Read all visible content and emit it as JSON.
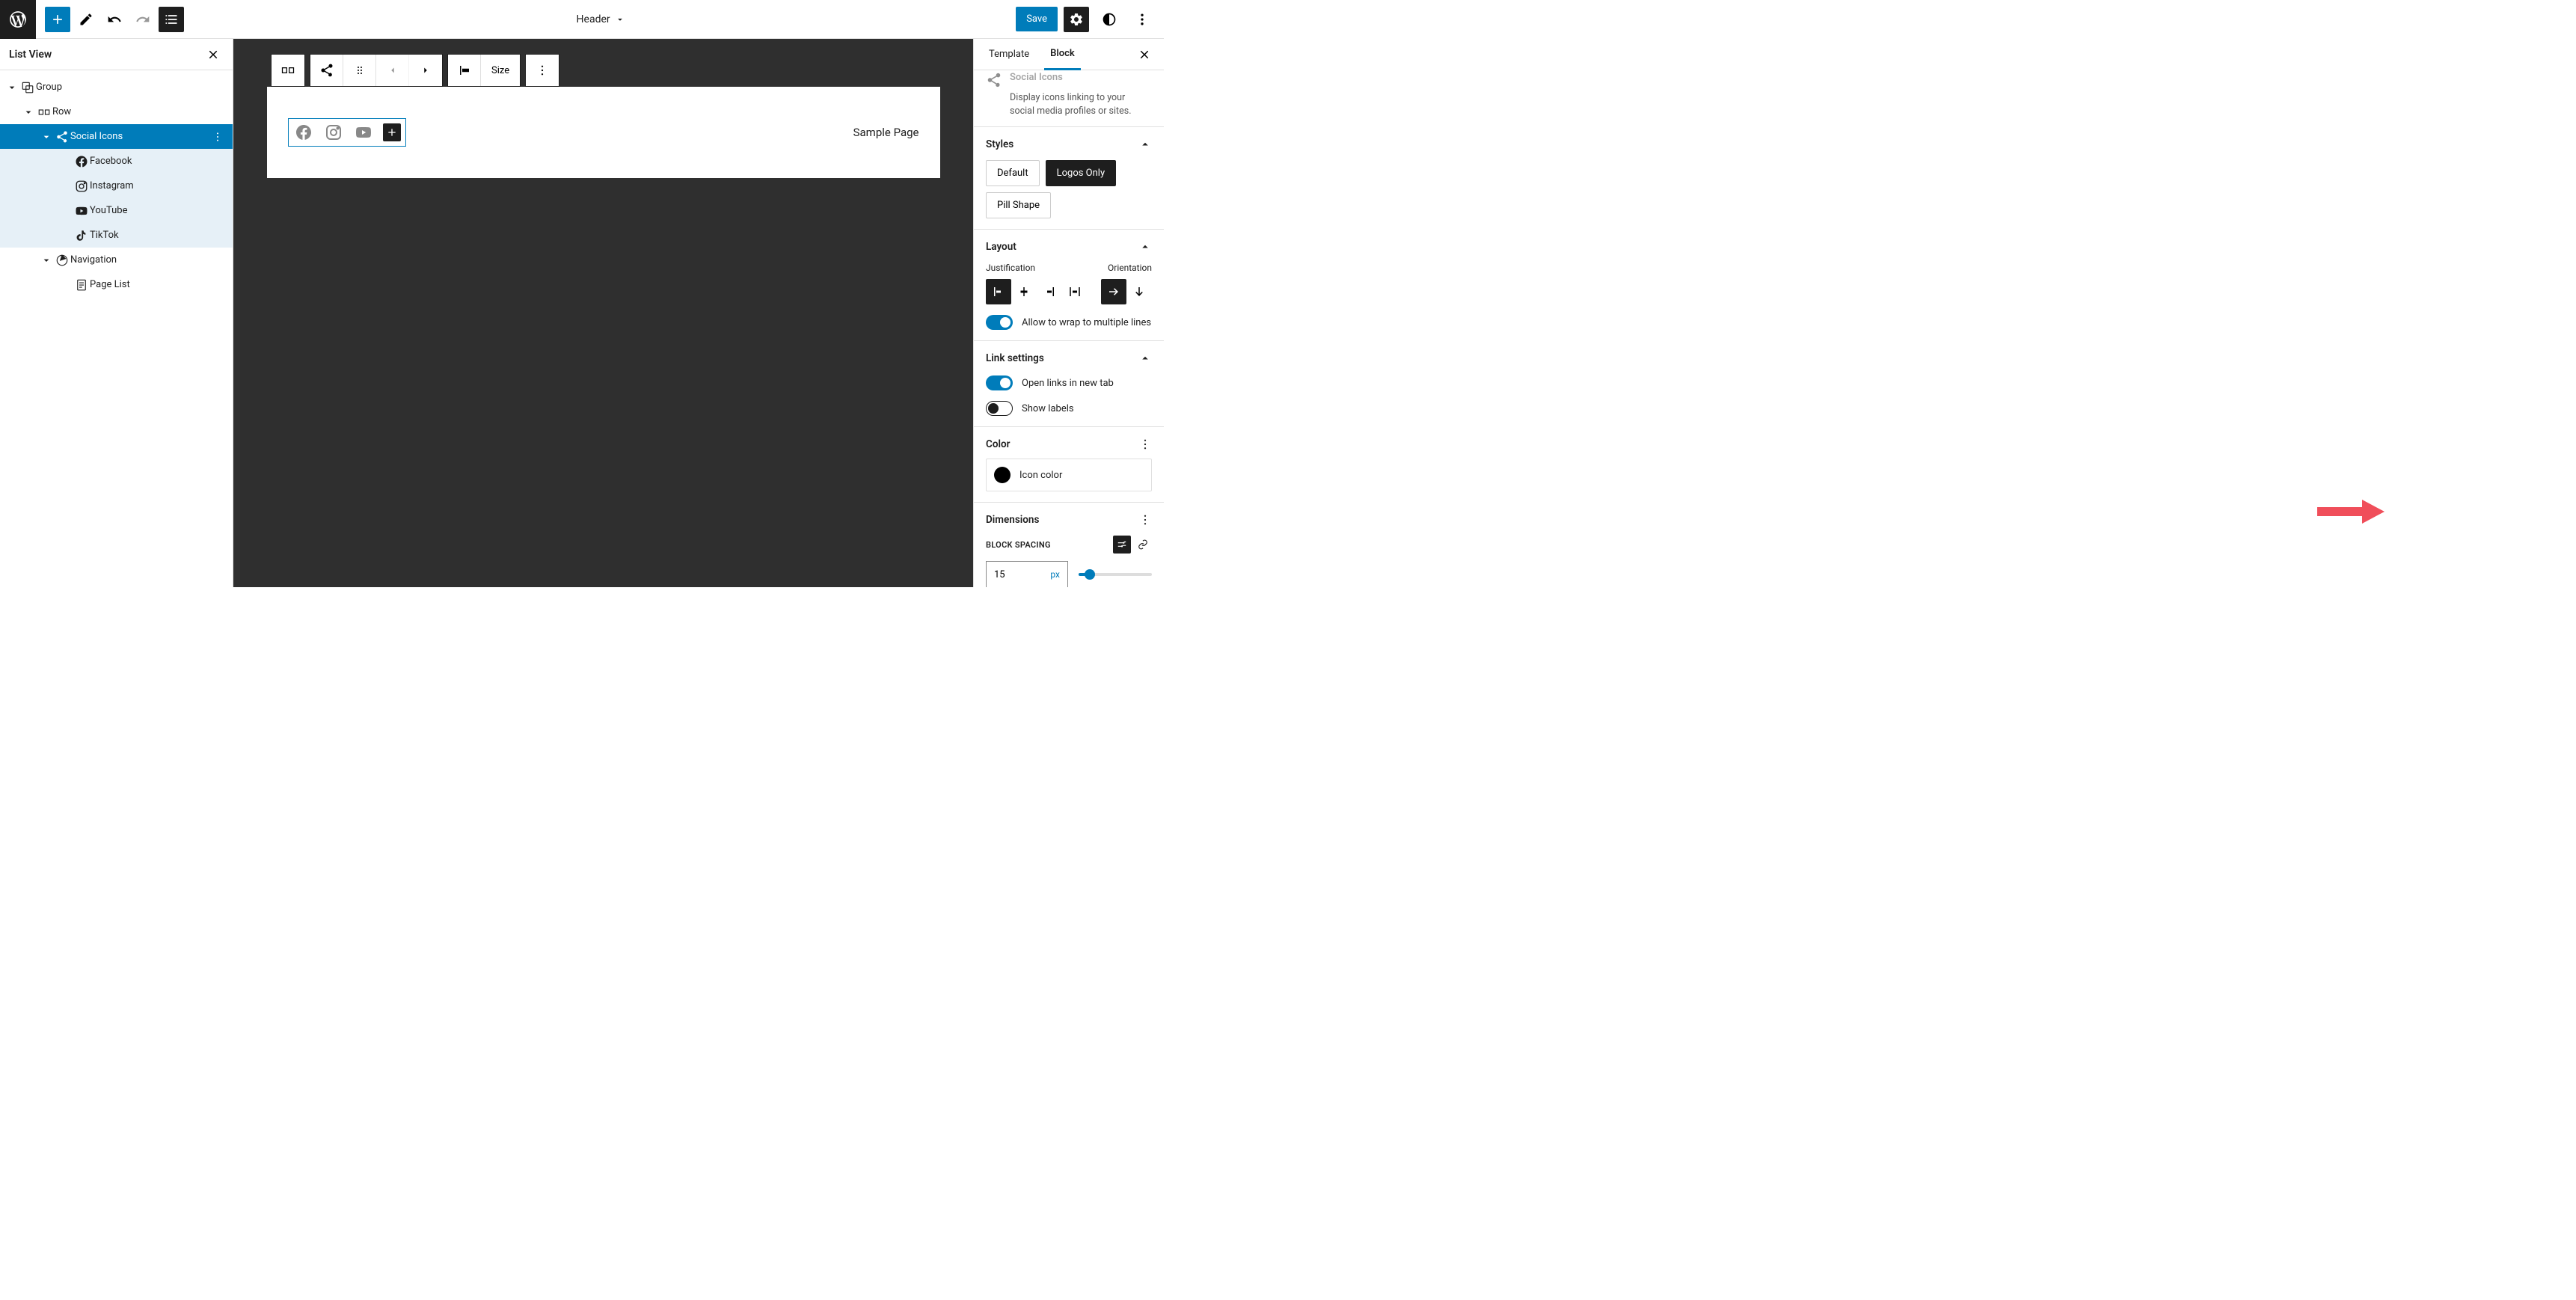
{
  "topbar": {
    "center_label": "Header",
    "save_label": "Save"
  },
  "list_view": {
    "title": "List View",
    "items": {
      "group": "Group",
      "row": "Row",
      "social_icons": "Social Icons",
      "facebook": "Facebook",
      "instagram": "Instagram",
      "youtube": "YouTube",
      "tiktok": "TikTok",
      "navigation": "Navigation",
      "page_list": "Page List"
    }
  },
  "toolbar": {
    "size_label": "Size"
  },
  "canvas": {
    "sample_page": "Sample Page"
  },
  "settings": {
    "tabs": {
      "template": "Template",
      "block": "Block"
    },
    "block_name": "Social Icons",
    "block_desc": "Display icons linking to your social media profiles or sites.",
    "styles": {
      "title": "Styles",
      "default": "Default",
      "logos_only": "Logos Only",
      "pill_shape": "Pill Shape"
    },
    "layout": {
      "title": "Layout",
      "justification": "Justification",
      "orientation": "Orientation",
      "wrap_label": "Allow to wrap to multiple lines"
    },
    "link_settings": {
      "title": "Link settings",
      "new_tab": "Open links in new tab",
      "show_labels": "Show labels"
    },
    "color": {
      "title": "Color",
      "icon_color": "Icon color"
    },
    "dimensions": {
      "title": "Dimensions",
      "block_spacing": "Block Spacing",
      "value": "15",
      "unit": "px"
    }
  }
}
